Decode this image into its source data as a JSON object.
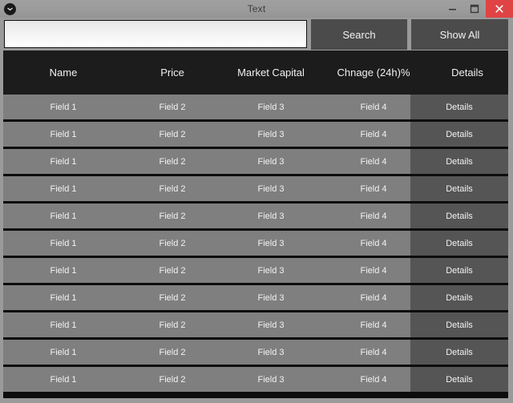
{
  "window": {
    "title": "Text",
    "app_icon": "app-logo-icon",
    "controls": {
      "minimize": "minimize-icon",
      "maximize": "maximize-icon",
      "close": "close-icon"
    },
    "colors": {
      "titlebar": "#9a9a9a",
      "close_button": "#e04344",
      "header_band": "#1c1c1c",
      "row": "#7f7f7f",
      "details_button": "#555555",
      "toolbar_button": "#4b4b4b"
    }
  },
  "search": {
    "value": "",
    "placeholder": "",
    "search_label": "Search",
    "show_all_label": "Show All"
  },
  "table": {
    "columns": [
      "Name",
      "Price",
      "Market Capital",
      "Chnage (24h)%",
      "Details"
    ],
    "action_label": "Details",
    "rows": [
      {
        "name": "Field 1",
        "price": "Field 2",
        "market_capital": "Field 3",
        "change_24h": "Field 4",
        "action": "Details"
      },
      {
        "name": "Field 1",
        "price": "Field 2",
        "market_capital": "Field 3",
        "change_24h": "Field 4",
        "action": "Details"
      },
      {
        "name": "Field 1",
        "price": "Field 2",
        "market_capital": "Field 3",
        "change_24h": "Field 4",
        "action": "Details"
      },
      {
        "name": "Field 1",
        "price": "Field 2",
        "market_capital": "Field 3",
        "change_24h": "Field 4",
        "action": "Details"
      },
      {
        "name": "Field 1",
        "price": "Field 2",
        "market_capital": "Field 3",
        "change_24h": "Field 4",
        "action": "Details"
      },
      {
        "name": "Field 1",
        "price": "Field 2",
        "market_capital": "Field 3",
        "change_24h": "Field 4",
        "action": "Details"
      },
      {
        "name": "Field 1",
        "price": "Field 2",
        "market_capital": "Field 3",
        "change_24h": "Field 4",
        "action": "Details"
      },
      {
        "name": "Field 1",
        "price": "Field 2",
        "market_capital": "Field 3",
        "change_24h": "Field 4",
        "action": "Details"
      },
      {
        "name": "Field 1",
        "price": "Field 2",
        "market_capital": "Field 3",
        "change_24h": "Field 4",
        "action": "Details"
      },
      {
        "name": "Field 1",
        "price": "Field 2",
        "market_capital": "Field 3",
        "change_24h": "Field 4",
        "action": "Details"
      },
      {
        "name": "Field 1",
        "price": "Field 2",
        "market_capital": "Field 3",
        "change_24h": "Field 4",
        "action": "Details"
      }
    ]
  }
}
